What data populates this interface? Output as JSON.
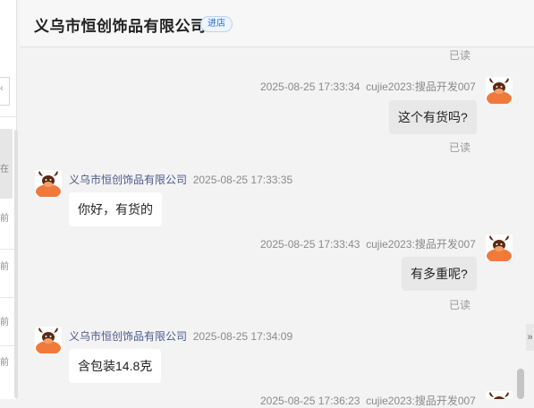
{
  "left_panel": {
    "fragments": [
      "在",
      "前",
      "前",
      "前",
      "前"
    ]
  },
  "header": {
    "title": "义乌市恒创饰品有限公司",
    "badge": "进店"
  },
  "messages": [
    {
      "type": "read",
      "text": "已读"
    },
    {
      "type": "outgoing",
      "time": "2025-08-25 17:33:34",
      "sender": "cujie2023:搜品开发007",
      "text": "这个有货吗?",
      "status": "已读"
    },
    {
      "type": "incoming",
      "sender": "义乌市恒创饰品有限公司",
      "time": "2025-08-25 17:33:35",
      "text": "你好，有货的"
    },
    {
      "type": "outgoing",
      "time": "2025-08-25 17:33:43",
      "sender": "cujie2023:搜品开发007",
      "text": "有多重呢?",
      "status": "已读"
    },
    {
      "type": "incoming",
      "sender": "义乌市恒创饰品有限公司",
      "time": "2025-08-25 17:34:09",
      "text": "含包装14.8克"
    },
    {
      "type": "outgoing-partial",
      "time": "2025-08-25 17:36:23",
      "sender": "cujie2023:搜品开发007"
    }
  ],
  "controls": {
    "collapse_arrow": "»"
  },
  "colors": {
    "avatar_orange": "#f07a3a",
    "avatar_dark": "#5a2a12",
    "sender_link": "#4a5a8a",
    "badge_blue": "#1e6fd9"
  },
  "icons": {
    "avatar": "cartoon-bull-avatar-icon",
    "collapse": "double-chevron-right-icon"
  }
}
